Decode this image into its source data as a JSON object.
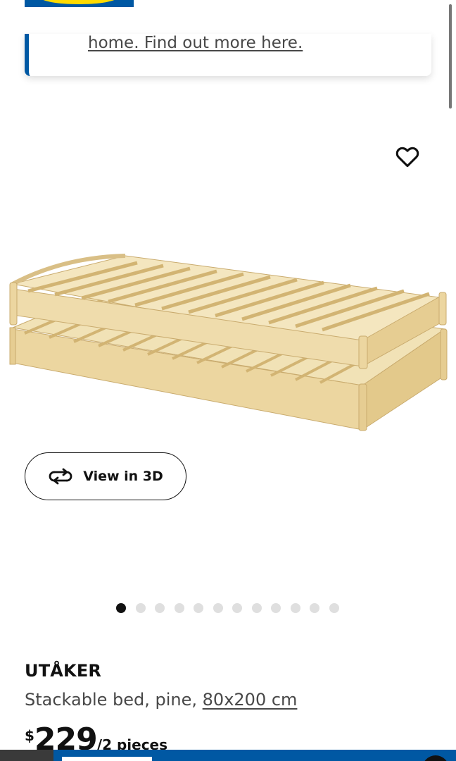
{
  "notice": {
    "link_text": "home. Find out more here."
  },
  "product": {
    "name": "UTÅKER",
    "description": "Stackable bed, pine, ",
    "size_link": "80x200 cm",
    "price_currency": "$",
    "price_value": "229",
    "price_unit": "/2 pieces"
  },
  "gallery": {
    "view3d_label": "View in 3D",
    "image_count": 12,
    "active_index": 0
  },
  "colors": {
    "brand_blue": "#0058a3",
    "brand_yellow": "#ffdb00",
    "wood": "#ecd9a6"
  }
}
